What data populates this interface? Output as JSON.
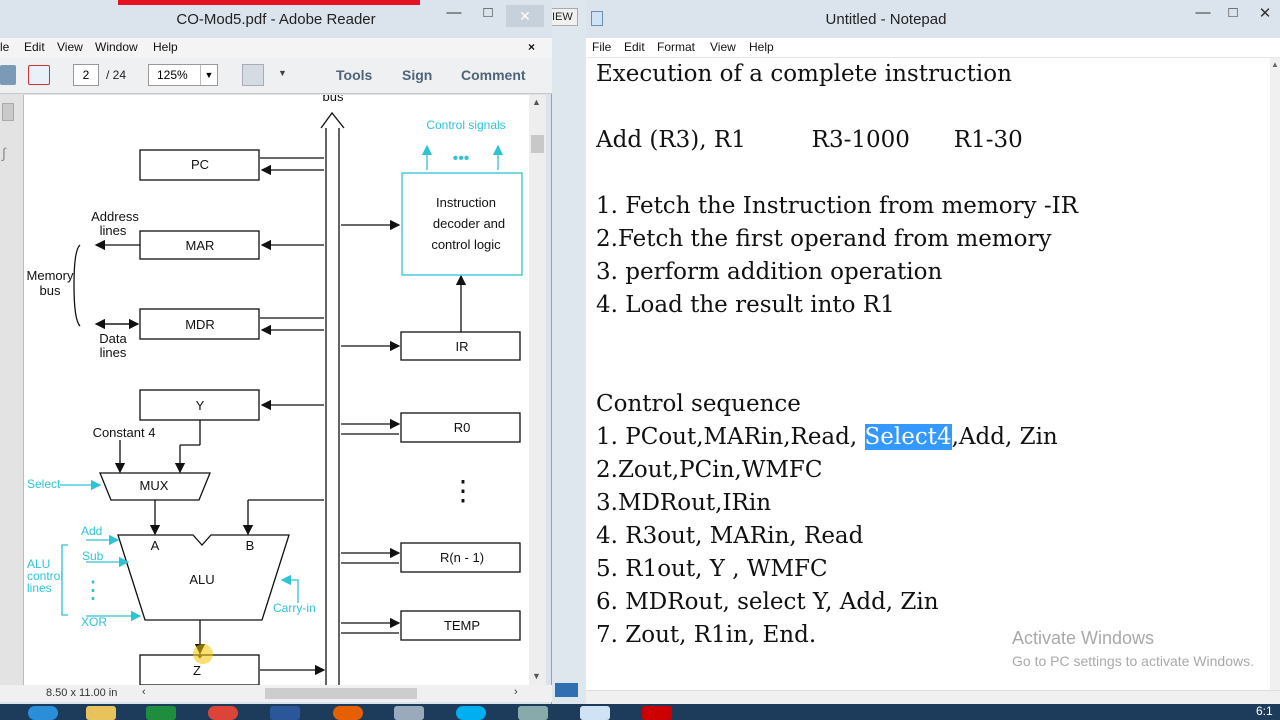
{
  "adobe": {
    "title": "CO-Mod5.pdf - Adobe Reader",
    "menu": [
      "le",
      "Edit",
      "View",
      "Window",
      "Help"
    ],
    "page_current": "2",
    "page_total": "/ 24",
    "zoom": "125%",
    "tools": "Tools",
    "sign": "Sign",
    "comment": "Comment",
    "page_size": "8.50 x 11.00 in",
    "behind_tab_text": "IEW"
  },
  "diagram": {
    "bus_label": "bus",
    "control_signals": "Control signals",
    "dots": "•••",
    "decoder": [
      "Instruction",
      "decoder and",
      "control logic"
    ],
    "pc": "PC",
    "mar": "MAR",
    "mdr": "MDR",
    "y": "Y",
    "ir": "IR",
    "r0": "R0",
    "rn1": "R(n - 1)",
    "temp": "TEMP",
    "mux": "MUX",
    "alu": "ALU",
    "z": "Z",
    "address_lines": [
      "Address",
      "lines"
    ],
    "memory_bus": [
      "Memory",
      "bus"
    ],
    "data_lines": [
      "Data",
      "lines"
    ],
    "constant4": "Constant 4",
    "select": "Select",
    "a": "A",
    "b": "B",
    "add": "Add",
    "sub": "Sub",
    "alu_control": [
      "ALU",
      "control",
      "lines"
    ],
    "xor": "XOR",
    "carry_in": "Carry-in"
  },
  "notepad": {
    "title": "Untitled - Notepad",
    "menu": [
      "File",
      "Edit",
      "Format",
      "View",
      "Help"
    ],
    "lines": {
      "l1": "Execution of a complete instruction",
      "l2": "",
      "l3": "Add (R3), R1         R3-1000      R1-30",
      "l4": "",
      "l5": "1. Fetch the Instruction from memory -IR",
      "l6": "2.Fetch the first operand from memory",
      "l7": "3. perform addition operation",
      "l8": "4. Load the result into R1",
      "l9": "",
      "l10": "",
      "l11": "Control sequence",
      "l12a": "1. PCout,MARin,Read, ",
      "l12sel": "Select4",
      "l12b": ",Add, Zin",
      "l13": "2.Zout,PCin,WMFC",
      "l14": "3.MDRout,IRin",
      "l15": "4. R3out, MARin, Read",
      "l16": "5. R1out, Y , WMFC",
      "l17": "6. MDRout, select Y, Add, Zin",
      "l18": "7. Zout, R1in, End."
    },
    "activate_title": "Activate Windows",
    "activate_sub": "Go to PC settings to activate Windows."
  },
  "taskbar": {
    "clock": "6:1"
  },
  "colors": {
    "title_bar": "#dbe4ed",
    "selection": "#3399ff",
    "cyan_diagram": "#2ec4d6",
    "taskbar": "#1d3c5c"
  }
}
